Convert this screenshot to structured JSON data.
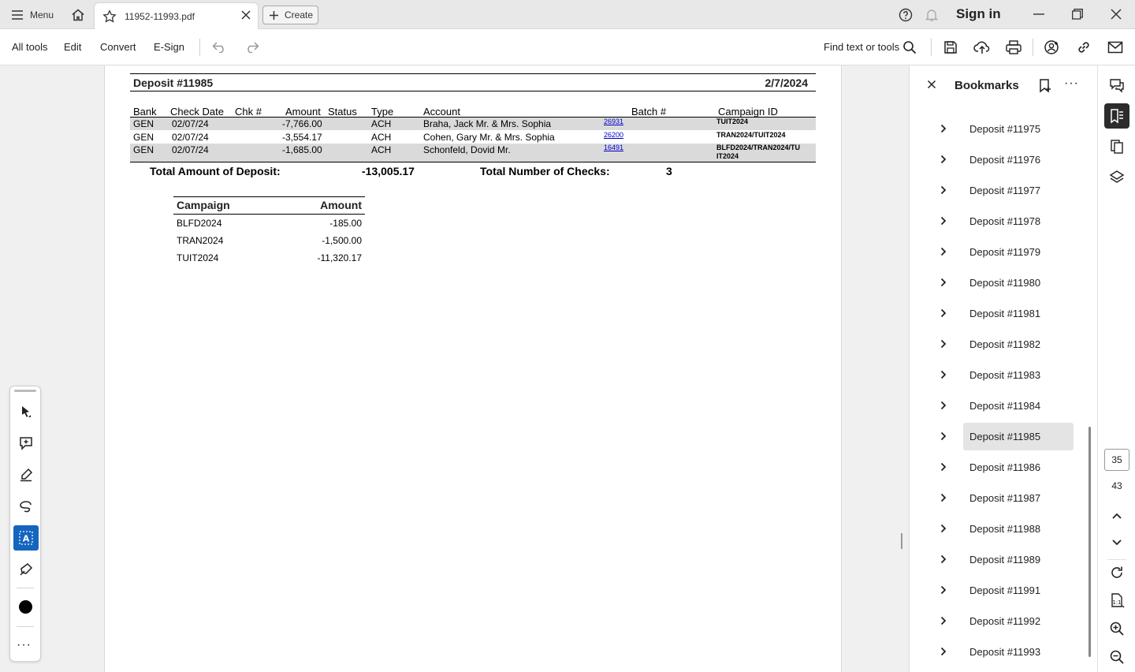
{
  "titlebar": {
    "menu_label": "Menu",
    "tab_title": "11952-11993.pdf",
    "create_label": "Create",
    "sign_in": "Sign in"
  },
  "toolbar": {
    "all_tools": "All tools",
    "edit": "Edit",
    "convert": "Convert",
    "esign": "E-Sign",
    "find_label": "Find text or tools"
  },
  "document": {
    "deposit_title": "Deposit #11985",
    "deposit_date": "2/7/2024",
    "columns": [
      "Bank",
      "Check Date",
      "Chk #",
      "Amount",
      "Status",
      "Type",
      "Account",
      "Batch #",
      "Campaign ID"
    ],
    "rows": [
      {
        "bank": "GEN",
        "date": "02/07/24",
        "amount": "-7,766.00",
        "type": "ACH",
        "account": "Braha, Jack Mr. & Mrs. Sophia",
        "link": "26931",
        "campaign": "TUIT2024"
      },
      {
        "bank": "GEN",
        "date": "02/07/24",
        "amount": "-3,554.17",
        "type": "ACH",
        "account": "Cohen, Gary Mr. & Mrs. Sophia",
        "link": "26200",
        "campaign": "TRAN2024/TUIT2024"
      },
      {
        "bank": "GEN",
        "date": "02/07/24",
        "amount": "-1,685.00",
        "type": "ACH",
        "account": "Schonfeld, Dovid Mr.",
        "link": "16491",
        "campaign": "BLFD2024/TRAN2024/TU IT2024"
      }
    ],
    "total_amount_label": "Total Amount of Deposit:",
    "total_amount": "-13,005.17",
    "total_checks_label": "Total Number of Checks:",
    "total_checks": "3",
    "campaign_table": {
      "header_campaign": "Campaign",
      "header_amount": "Amount",
      "rows": [
        {
          "campaign": "BLFD2024",
          "amount": "-185.00"
        },
        {
          "campaign": "TRAN2024",
          "amount": "-1,500.00"
        },
        {
          "campaign": "TUIT2024",
          "amount": "-11,320.17"
        }
      ]
    }
  },
  "bookmarks": {
    "title": "Bookmarks",
    "selected": "Deposit #11985",
    "items": [
      "Deposit #11975",
      "Deposit #11976",
      "Deposit #11977",
      "Deposit #11978",
      "Deposit #11979",
      "Deposit #11980",
      "Deposit #11981",
      "Deposit #11982",
      "Deposit #11983",
      "Deposit #11984",
      "Deposit #11985",
      "Deposit #11986",
      "Deposit #11987",
      "Deposit #11988",
      "Deposit #11989",
      "Deposit #11991",
      "Deposit #11992",
      "Deposit #11993"
    ]
  },
  "pagination": {
    "current_page": "35",
    "total_pages": "43"
  },
  "colors": {
    "accent": "#1565c0",
    "link": "#0000cc",
    "row_shade": "#dadada",
    "selected_bookmark": "#e4e4e4"
  }
}
